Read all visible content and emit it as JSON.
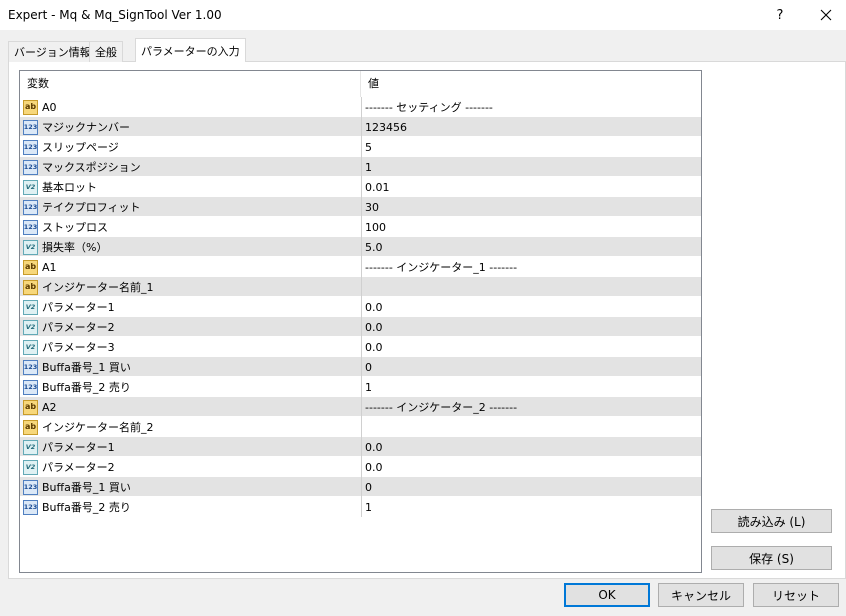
{
  "window": {
    "title": "Expert - Mq & Mq_SignTool Ver 1.00",
    "help": "?"
  },
  "tabs": [
    {
      "label": "バージョン情報",
      "active": false
    },
    {
      "label": "全般",
      "active": false
    },
    {
      "label": "パラメーターの入力",
      "active": true
    }
  ],
  "grid": {
    "columns": [
      "変数",
      "値"
    ],
    "rows": [
      {
        "type": "ab",
        "name": "A0",
        "value": "------- セッティング -------"
      },
      {
        "type": "int",
        "name": "マジックナンバー",
        "value": "123456"
      },
      {
        "type": "int",
        "name": "スリップページ",
        "value": "5"
      },
      {
        "type": "int",
        "name": "マックスポジション",
        "value": "1"
      },
      {
        "type": "dbl",
        "name": "基本ロット",
        "value": "0.01"
      },
      {
        "type": "int",
        "name": "テイクプロフィット",
        "value": "30"
      },
      {
        "type": "int",
        "name": "ストップロス",
        "value": "100"
      },
      {
        "type": "dbl",
        "name": "損失率（%）",
        "value": "5.0"
      },
      {
        "type": "ab",
        "name": "A1",
        "value": "------- インジケーター_1 -------"
      },
      {
        "type": "ab",
        "name": "インジケーター名前_1",
        "value": ""
      },
      {
        "type": "dbl",
        "name": "パラメーター1",
        "value": "0.0"
      },
      {
        "type": "dbl",
        "name": "パラメーター2",
        "value": "0.0"
      },
      {
        "type": "dbl",
        "name": "パラメーター3",
        "value": "0.0"
      },
      {
        "type": "int",
        "name": "Buffa番号_1 買い",
        "value": "0"
      },
      {
        "type": "int",
        "name": "Buffa番号_2 売り",
        "value": "1"
      },
      {
        "type": "ab",
        "name": "A2",
        "value": "------- インジケーター_2 -------"
      },
      {
        "type": "ab",
        "name": "インジケーター名前_2",
        "value": ""
      },
      {
        "type": "dbl",
        "name": "パラメーター1",
        "value": "0.0"
      },
      {
        "type": "dbl",
        "name": "パラメーター2",
        "value": "0.0"
      },
      {
        "type": "int",
        "name": "Buffa番号_1 買い",
        "value": "0"
      },
      {
        "type": "int",
        "name": "Buffa番号_2 売り",
        "value": "1"
      }
    ]
  },
  "icons": {
    "ab": "ab",
    "int": "123",
    "dbl": "V2"
  },
  "buttons": {
    "load": "読み込み (L)",
    "save": "保存 (S)",
    "ok": "OK",
    "cancel": "キャンセル",
    "reset": "リセット"
  }
}
